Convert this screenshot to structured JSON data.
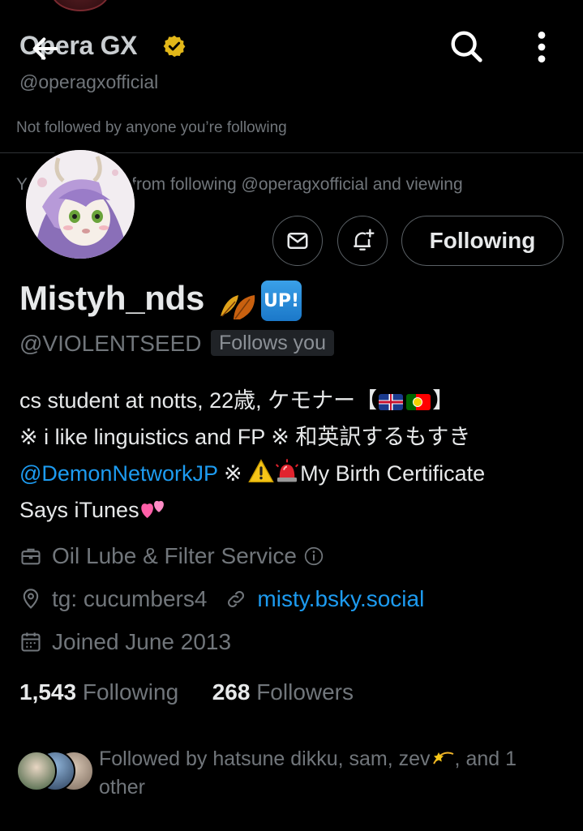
{
  "header": {
    "profile_name": "Opera GX",
    "profile_handle": "@operagxofficial",
    "not_followed_text": "Not followed by anyone you’re following",
    "blocked_text": "You're blocked from following @operagxofficial and viewing"
  },
  "actions": {
    "follow_label": "Following"
  },
  "profile": {
    "display_name": "Mistyh_nds",
    "up_badge": "UP!",
    "handle": "@VIOLENTSEED",
    "follows_you": "Follows you",
    "bio": {
      "line1_text": "cs student at notts, 22歳, ケモナー【",
      "line1_end": "】",
      "line2": "※ i like linguistics and FP ※ 和英訳するもすき",
      "mention": "@DemonNetworkJP",
      "after_mention": " ※ ",
      "line3_text": "My Birth Certificate",
      "line4": "Says iTunes"
    },
    "work": "Oil Lube & Filter Service",
    "location": "tg: cucumbers4",
    "website": "misty.bsky.social",
    "joined": "Joined June 2013",
    "following_count": "1,543",
    "following_label": "Following",
    "followers_count": "268",
    "followers_label": "Followers",
    "followed_by_text": "Followed by hatsune dikku, sam, zev",
    "followed_by_end": ", and 1 other"
  },
  "colors": {
    "background": "#000000",
    "primary_text": "#e7e9ea",
    "secondary_text": "#71767b",
    "link": "#1d9bf0",
    "verified_gold": "#e2b719"
  },
  "icons": [
    "back-arrow-icon",
    "search-icon",
    "more-vert-icon",
    "verified-badge-icon",
    "mail-icon",
    "bell-plus-icon",
    "briefcase-icon",
    "info-icon",
    "location-pin-icon",
    "link-icon",
    "calendar-icon"
  ]
}
